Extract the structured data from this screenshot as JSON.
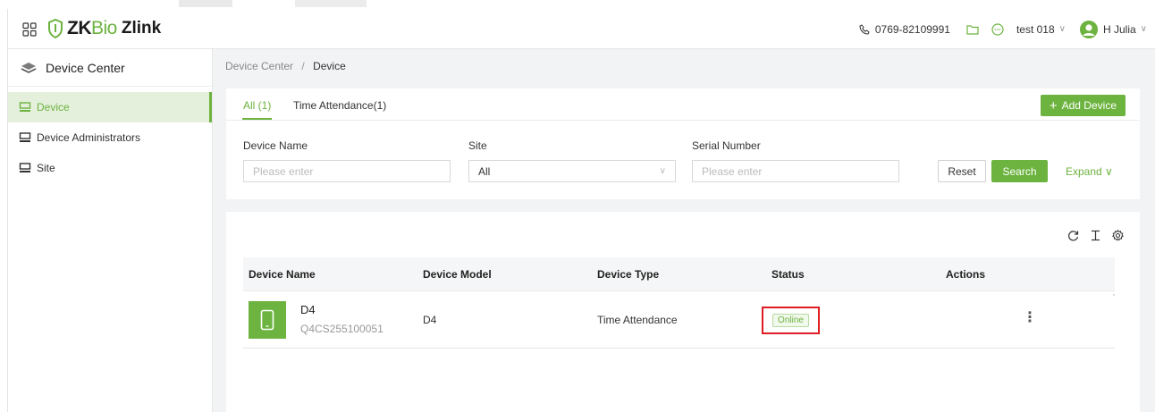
{
  "header": {
    "brand_zk": "ZK",
    "brand_bio": "Bio",
    "brand_app": "Zlink",
    "phone": "0769-82109991",
    "org": "test 018",
    "user": "H Julia"
  },
  "sidebar": {
    "module_title": "Device Center",
    "items": [
      {
        "label": "Device",
        "active": true
      },
      {
        "label": "Device Administrators",
        "active": false
      },
      {
        "label": "Site",
        "active": false
      }
    ]
  },
  "breadcrumb": {
    "parent": "Device Center",
    "separator": "/",
    "current": "Device"
  },
  "tabs": [
    {
      "label": "All (1)",
      "active": true
    },
    {
      "label": "Time Attendance(1)",
      "active": false
    }
  ],
  "toolbar": {
    "add_device_label": "Add Device"
  },
  "filters": {
    "device_name_label": "Device Name",
    "device_name_placeholder": "Please enter",
    "site_label": "Site",
    "site_value": "All",
    "serial_number_label": "Serial Number",
    "serial_number_placeholder": "Please enter",
    "reset_label": "Reset",
    "search_label": "Search",
    "expand_label": "Expand"
  },
  "table": {
    "columns": [
      "Device Name",
      "Device Model",
      "Device Type",
      "Status",
      "Actions"
    ],
    "rows": [
      {
        "device_name": "D4",
        "serial_number": "Q4CS255100051",
        "device_model": "D4",
        "device_type": "Time Attendance",
        "status": "Online",
        "actions": "⋮"
      }
    ]
  },
  "colors": {
    "accent": "#6cb33f",
    "highlight_border": "#e01b24"
  }
}
